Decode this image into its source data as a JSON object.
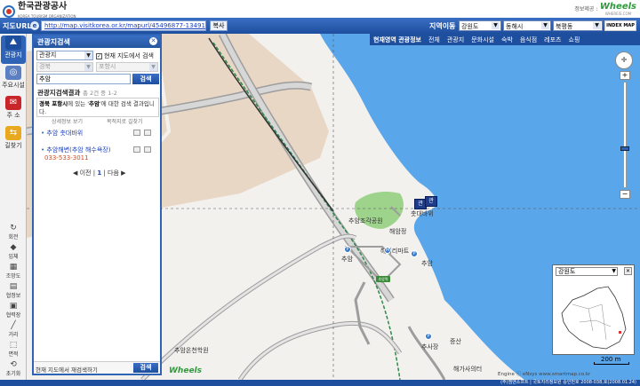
{
  "header": {
    "org_name": "한국관광공사",
    "org_name_en": "KOREA TOURISM ORGANIZATION",
    "provider_label": "정보제공 :",
    "provider_brand": "Wheels",
    "provider_sub": "WHEREIS.COM"
  },
  "urlbar": {
    "title": "지도URL",
    "url": "http://map.visitkorea.or.kr/mapurl/45496877-1349173b",
    "copy_label": "복사",
    "region_label": "지역이동",
    "province": "강원도",
    "city": "동해시",
    "district": "북평동",
    "index_map_label": "INDEX MAP"
  },
  "leftnav": {
    "items": [
      {
        "label": "관광지"
      },
      {
        "label": "주요시설"
      },
      {
        "label": "주 소"
      },
      {
        "label": "길찾기"
      }
    ],
    "tools": [
      {
        "label": "회전"
      },
      {
        "label": "입체"
      },
      {
        "label": "조망도"
      },
      {
        "label": "협정보"
      },
      {
        "label": "협력장"
      },
      {
        "label": "거리"
      },
      {
        "label": "면적"
      },
      {
        "label": "초기화"
      }
    ]
  },
  "panel": {
    "title": "관광지검색",
    "category": "관광지",
    "current_map_check": "현재 지도에서 검색",
    "province_placeholder": "경북",
    "city_placeholder": "포항시",
    "query": "추암",
    "search_label": "검색",
    "result_title": "관광지검색결과",
    "result_count": "총 2건 중 1-2",
    "result_msg_prefix": "경북 포항시",
    "result_msg_mid": "에 있는 '",
    "result_msg_query": "추암",
    "result_msg_suffix": "'에 대한 검색 결과입니다.",
    "detail_link": "상세정보 보기",
    "dest_link": "목적지로 길찾기",
    "results": [
      {
        "name": "추암 촛대바위",
        "phone": ""
      },
      {
        "name": "추암해변(추암 해수욕장)",
        "phone": "033-533-3011"
      }
    ],
    "pager_prev": "◀ 이전",
    "pager_page": "1",
    "pager_next": "다음 ▶",
    "footer_text": "현재 지도에서 재검색하기",
    "footer_btn": "검색"
  },
  "tabs": {
    "items": [
      "현재영역 관광정보",
      "전체",
      "관광지",
      "문화시설",
      "숙박",
      "음식점",
      "레포츠",
      "쇼핑"
    ]
  },
  "map": {
    "labels": {
      "park": "추암조각공원",
      "rock": "촛대바위",
      "pavilion": "해암정",
      "mart": "해미리마트",
      "chuam_bus": "추암",
      "chuam_sign": "추암",
      "chuam_stn": "추암역",
      "hotel": "추암온천학원",
      "jeungsan": "증산",
      "jeungsan_bus": "추사장",
      "haega": "해가사의터"
    },
    "minimap_region": "강원도",
    "scale_label": "200 m",
    "credit": "Engine ⓒ eNsys www.smartmap.co.kr",
    "copyright": "(주)엠엔소프트 | 국토지리정보원 승인번호 2008-038,호(2008.01.24)",
    "water_color": "#5aa6ea",
    "land_color": "#f3f1ee",
    "urban_color": "#e9d7c6",
    "road_color": "#9d9d9d",
    "rail_color": "#2e8a4b"
  }
}
